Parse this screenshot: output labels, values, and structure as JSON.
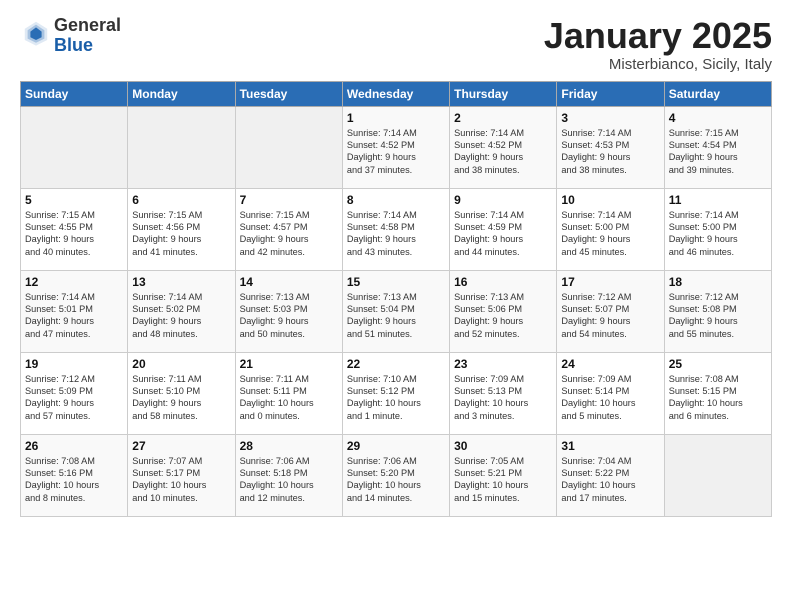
{
  "header": {
    "logo_general": "General",
    "logo_blue": "Blue",
    "month_title": "January 2025",
    "location": "Misterbianco, Sicily, Italy"
  },
  "days_of_week": [
    "Sunday",
    "Monday",
    "Tuesday",
    "Wednesday",
    "Thursday",
    "Friday",
    "Saturday"
  ],
  "weeks": [
    [
      {
        "day": "",
        "info": ""
      },
      {
        "day": "",
        "info": ""
      },
      {
        "day": "",
        "info": ""
      },
      {
        "day": "1",
        "info": "Sunrise: 7:14 AM\nSunset: 4:52 PM\nDaylight: 9 hours\nand 37 minutes."
      },
      {
        "day": "2",
        "info": "Sunrise: 7:14 AM\nSunset: 4:52 PM\nDaylight: 9 hours\nand 38 minutes."
      },
      {
        "day": "3",
        "info": "Sunrise: 7:14 AM\nSunset: 4:53 PM\nDaylight: 9 hours\nand 38 minutes."
      },
      {
        "day": "4",
        "info": "Sunrise: 7:15 AM\nSunset: 4:54 PM\nDaylight: 9 hours\nand 39 minutes."
      }
    ],
    [
      {
        "day": "5",
        "info": "Sunrise: 7:15 AM\nSunset: 4:55 PM\nDaylight: 9 hours\nand 40 minutes."
      },
      {
        "day": "6",
        "info": "Sunrise: 7:15 AM\nSunset: 4:56 PM\nDaylight: 9 hours\nand 41 minutes."
      },
      {
        "day": "7",
        "info": "Sunrise: 7:15 AM\nSunset: 4:57 PM\nDaylight: 9 hours\nand 42 minutes."
      },
      {
        "day": "8",
        "info": "Sunrise: 7:14 AM\nSunset: 4:58 PM\nDaylight: 9 hours\nand 43 minutes."
      },
      {
        "day": "9",
        "info": "Sunrise: 7:14 AM\nSunset: 4:59 PM\nDaylight: 9 hours\nand 44 minutes."
      },
      {
        "day": "10",
        "info": "Sunrise: 7:14 AM\nSunset: 5:00 PM\nDaylight: 9 hours\nand 45 minutes."
      },
      {
        "day": "11",
        "info": "Sunrise: 7:14 AM\nSunset: 5:00 PM\nDaylight: 9 hours\nand 46 minutes."
      }
    ],
    [
      {
        "day": "12",
        "info": "Sunrise: 7:14 AM\nSunset: 5:01 PM\nDaylight: 9 hours\nand 47 minutes."
      },
      {
        "day": "13",
        "info": "Sunrise: 7:14 AM\nSunset: 5:02 PM\nDaylight: 9 hours\nand 48 minutes."
      },
      {
        "day": "14",
        "info": "Sunrise: 7:13 AM\nSunset: 5:03 PM\nDaylight: 9 hours\nand 50 minutes."
      },
      {
        "day": "15",
        "info": "Sunrise: 7:13 AM\nSunset: 5:04 PM\nDaylight: 9 hours\nand 51 minutes."
      },
      {
        "day": "16",
        "info": "Sunrise: 7:13 AM\nSunset: 5:06 PM\nDaylight: 9 hours\nand 52 minutes."
      },
      {
        "day": "17",
        "info": "Sunrise: 7:12 AM\nSunset: 5:07 PM\nDaylight: 9 hours\nand 54 minutes."
      },
      {
        "day": "18",
        "info": "Sunrise: 7:12 AM\nSunset: 5:08 PM\nDaylight: 9 hours\nand 55 minutes."
      }
    ],
    [
      {
        "day": "19",
        "info": "Sunrise: 7:12 AM\nSunset: 5:09 PM\nDaylight: 9 hours\nand 57 minutes."
      },
      {
        "day": "20",
        "info": "Sunrise: 7:11 AM\nSunset: 5:10 PM\nDaylight: 9 hours\nand 58 minutes."
      },
      {
        "day": "21",
        "info": "Sunrise: 7:11 AM\nSunset: 5:11 PM\nDaylight: 10 hours\nand 0 minutes."
      },
      {
        "day": "22",
        "info": "Sunrise: 7:10 AM\nSunset: 5:12 PM\nDaylight: 10 hours\nand 1 minute."
      },
      {
        "day": "23",
        "info": "Sunrise: 7:09 AM\nSunset: 5:13 PM\nDaylight: 10 hours\nand 3 minutes."
      },
      {
        "day": "24",
        "info": "Sunrise: 7:09 AM\nSunset: 5:14 PM\nDaylight: 10 hours\nand 5 minutes."
      },
      {
        "day": "25",
        "info": "Sunrise: 7:08 AM\nSunset: 5:15 PM\nDaylight: 10 hours\nand 6 minutes."
      }
    ],
    [
      {
        "day": "26",
        "info": "Sunrise: 7:08 AM\nSunset: 5:16 PM\nDaylight: 10 hours\nand 8 minutes."
      },
      {
        "day": "27",
        "info": "Sunrise: 7:07 AM\nSunset: 5:17 PM\nDaylight: 10 hours\nand 10 minutes."
      },
      {
        "day": "28",
        "info": "Sunrise: 7:06 AM\nSunset: 5:18 PM\nDaylight: 10 hours\nand 12 minutes."
      },
      {
        "day": "29",
        "info": "Sunrise: 7:06 AM\nSunset: 5:20 PM\nDaylight: 10 hours\nand 14 minutes."
      },
      {
        "day": "30",
        "info": "Sunrise: 7:05 AM\nSunset: 5:21 PM\nDaylight: 10 hours\nand 15 minutes."
      },
      {
        "day": "31",
        "info": "Sunrise: 7:04 AM\nSunset: 5:22 PM\nDaylight: 10 hours\nand 17 minutes."
      },
      {
        "day": "",
        "info": ""
      }
    ]
  ]
}
